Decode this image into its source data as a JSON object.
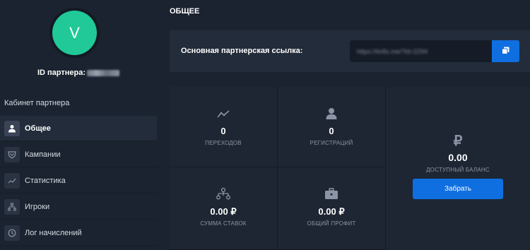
{
  "sidebar": {
    "avatar_letter": "V",
    "partner_id_label": "ID партнера:",
    "cabinet_title": "Кабинет партнера",
    "items": [
      {
        "label": "Общее",
        "icon": "user-icon",
        "active": true
      },
      {
        "label": "Кампании",
        "icon": "campaign-icon",
        "active": false
      },
      {
        "label": "Статистика",
        "icon": "chart-line-icon",
        "active": false
      },
      {
        "label": "Игроки",
        "icon": "players-icon",
        "active": false
      },
      {
        "label": "Лог начислений",
        "icon": "clock-icon",
        "active": false
      }
    ]
  },
  "main": {
    "title": "ОБЩЕЕ",
    "link_label": "Основная партнерская ссылка:",
    "link_value_blurred": "https://brillx.me/?id=2294",
    "copy_icon": "copy-icon"
  },
  "stats": {
    "transitions": {
      "value": "0",
      "label": "ПЕРЕХОДОВ",
      "icon": "trend-icon"
    },
    "registrations": {
      "value": "0",
      "label": "РЕГИСТРАЦИЙ",
      "icon": "user-icon"
    },
    "bets": {
      "value": "0.00 ₽",
      "label": "СУММА СТАВОК",
      "icon": "network-icon"
    },
    "profit": {
      "value": "0.00 ₽",
      "label": "ОБЩИЙ ПРОФИТ",
      "icon": "briefcase-icon"
    },
    "balance": {
      "value": "0.00",
      "label": "ДОСТУПНЫЙ БАЛАНС",
      "icon": "ruble-icon",
      "symbol": "₽"
    },
    "withdraw_label": "Забрать"
  },
  "colors": {
    "background": "#1b2330",
    "panel": "#232c3a",
    "accent": "#0f6fe0",
    "avatar": "#20c997",
    "muted_text": "#8b95a5"
  }
}
